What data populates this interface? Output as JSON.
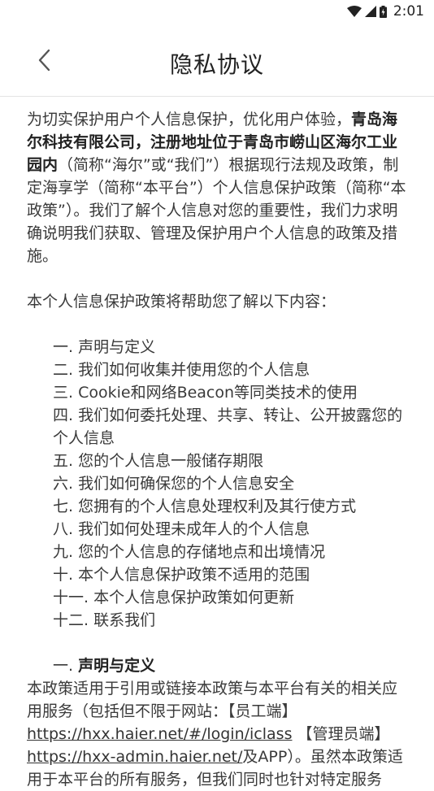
{
  "status_bar": {
    "time": "2:01"
  },
  "header": {
    "title": "隐私协议"
  },
  "intro": {
    "p1": "为切实保护用户个人信息保护，优化用户体验，",
    "b1": "青岛海尔科技有限公司，注册地址位于青岛市崂山区海尔工业园内",
    "p2": "（简称“海尔”或“我们”）根据现行法规及政策，制定海享学（简称“本平台”）个人信息保护政策（简称“本政策”）。我们了解个人信息对您的重要性，我们力求明确说明我们获取、管理及保护用户个人信息的政策及措施。"
  },
  "toc_intro": "本个人信息保护政策将帮助您了解以下内容：",
  "toc": [
    "一. 声明与定义",
    "二. 我们如何收集并使用您的个人信息",
    "三. Cookie和网络Beacon等同类技术的使用",
    "四. 我们如何委托处理、共享、转让、公开披露您的个人信息",
    "五. 您的个人信息一般储存期限",
    "六. 我们如何确保您的个人信息安全",
    "七. 您拥有的个人信息处理权利及其行使方式",
    "八. 我们如何处理未成年人的个人信息",
    "九. 您的个人信息的存储地点和出境情况",
    "十. 本个人信息保护政策不适用的范围",
    "十一. 本个人信息保护政策如何更新",
    "十二. 联系我们"
  ],
  "section1": {
    "num": "一. ",
    "title": "声明与定义",
    "t1": "本政策适用于引用或链接本政策与本平台有关的相关应用服务（包括但不限于网站：【员工端】",
    "link1": "https://hxx.haier.net/#/login/iclass",
    "t2": " 【管理员端】",
    "link2": "https://hxx-admin.haier.net/",
    "t3": "及APP）。虽然本政策适用于本平台的所有服务，但我们同时也针对特定服务"
  }
}
